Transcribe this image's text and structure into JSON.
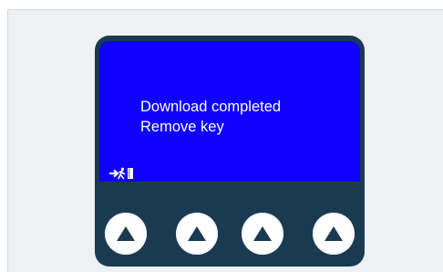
{
  "screen": {
    "line1": "Download completed",
    "line2": "Remove key",
    "exit_icon": "exit-icon"
  },
  "buttons": [
    {
      "icon": "up-arrow-icon"
    },
    {
      "icon": "up-arrow-icon"
    },
    {
      "icon": "up-arrow-icon"
    },
    {
      "icon": "up-arrow-icon"
    }
  ],
  "colors": {
    "screen_bg": "#0f00ff",
    "device_body": "#1a3a52",
    "panel_bg": "#eef0f3",
    "button": "#ffffff",
    "text": "#ffffff"
  }
}
